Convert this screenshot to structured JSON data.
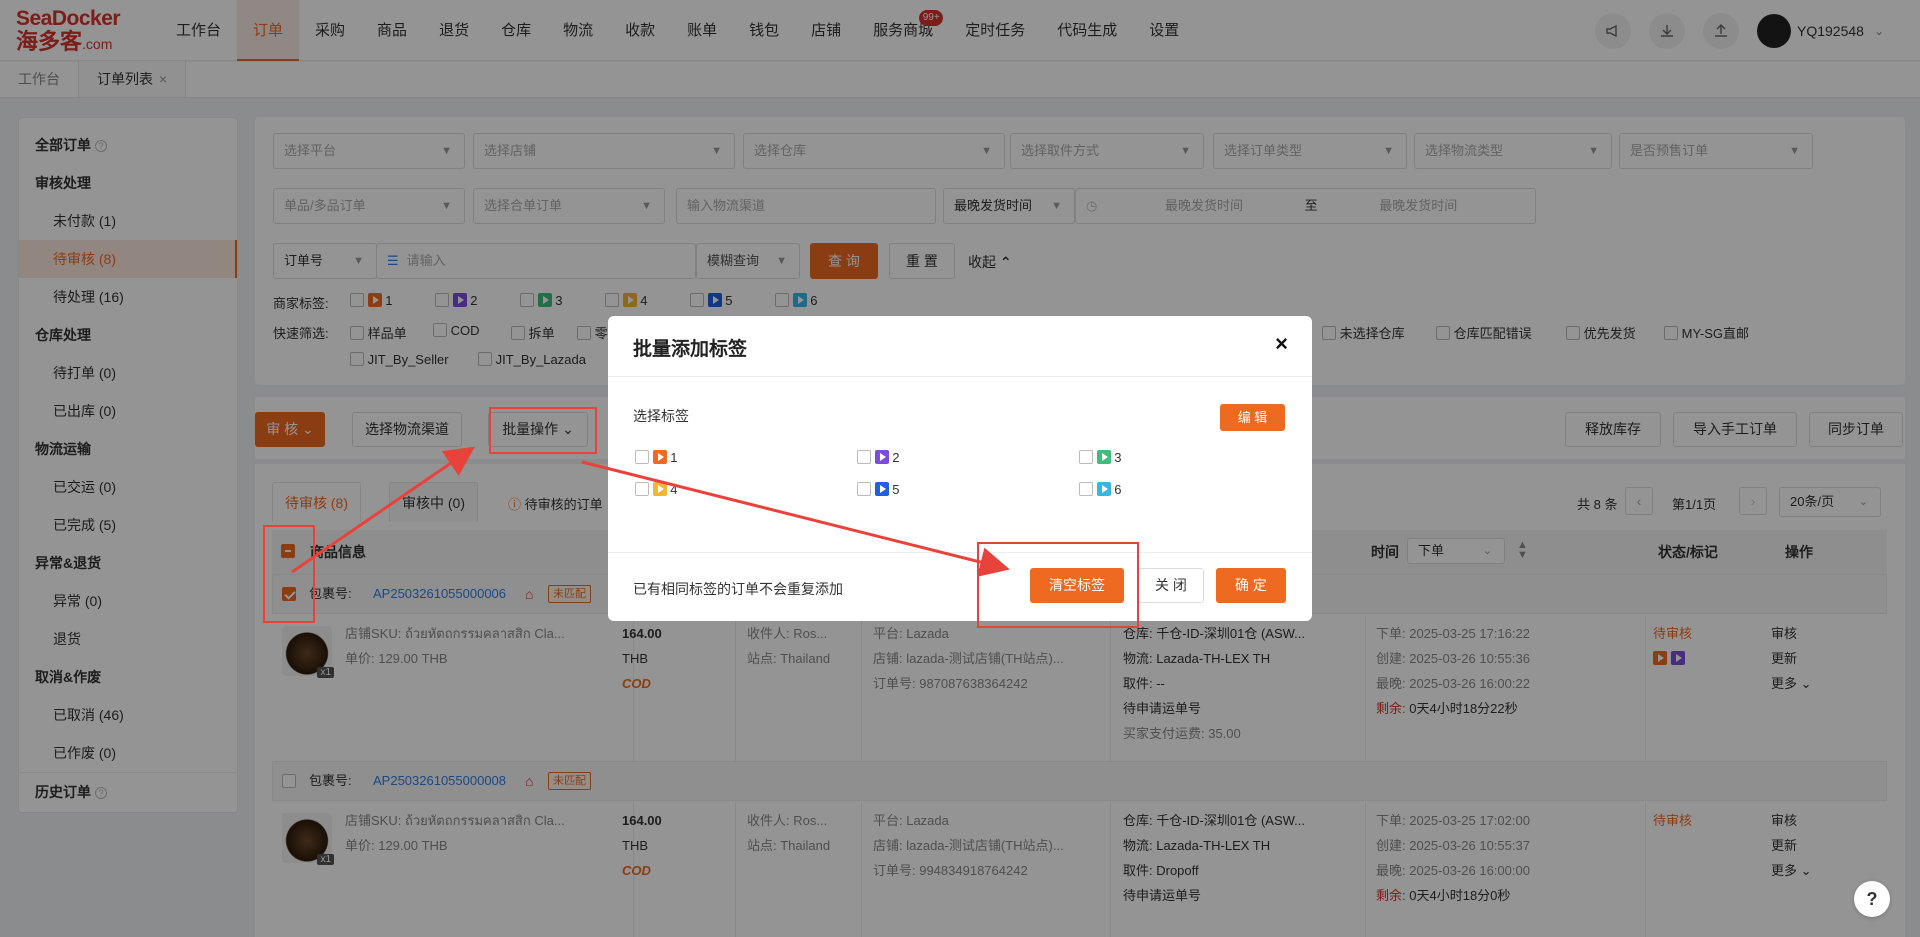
{
  "logo": {
    "top": "SeaDocker",
    "cn": "海多客",
    "suffix": ".com"
  },
  "nav": {
    "items": [
      "工作台",
      "订单",
      "采购",
      "商品",
      "退货",
      "仓库",
      "物流",
      "收款",
      "账单",
      "钱包",
      "店铺",
      "服务商城",
      "定时任务",
      "代码生成",
      "设置"
    ],
    "active_index": 1,
    "service_badge": "99+",
    "username": "YQ192548"
  },
  "page_tabs": [
    {
      "label": "工作台"
    },
    {
      "label": "订单列表",
      "close": "×"
    }
  ],
  "sidebar": {
    "all_orders": "全部订单",
    "groups": [
      {
        "title": "审核处理",
        "items": [
          "未付款 (1)",
          "待审核 (8)",
          "待处理 (16)"
        ]
      },
      {
        "title": "仓库处理",
        "items": [
          "待打单 (0)",
          "已出库 (0)"
        ]
      },
      {
        "title": "物流运输",
        "items": [
          "已交运 (0)",
          "已完成 (5)"
        ]
      },
      {
        "title": "异常&退货",
        "items": [
          "异常 (0)",
          "退货"
        ]
      },
      {
        "title": "取消&作废",
        "items": [
          "已取消 (46)",
          "已作废 (0)"
        ]
      }
    ],
    "history": "历史订单"
  },
  "filters": {
    "row1": [
      "选择平台",
      "选择店铺",
      "选择仓库",
      "选择取件方式",
      "选择订单类型",
      "选择物流类型",
      "是否预售订单"
    ],
    "row2": {
      "sku_type": "单品/多品订单",
      "merge": "选择合单订单",
      "channel_placeholder": "输入物流渠道",
      "time_type": "最晚发货时间",
      "range_start": "最晚发货时间",
      "range_sep": "至",
      "range_end": "最晚发货时间"
    },
    "row3": {
      "field": "订单号",
      "input_placeholder": "请输入",
      "match": "模糊查询",
      "query": "查 询",
      "reset": "重 置",
      "collapse": "收起"
    },
    "merchant_tags_label": "商家标签:",
    "merchant_tags": [
      "1",
      "2",
      "3",
      "4",
      "5",
      "6"
    ],
    "quick_label": "快速筛选:",
    "quick_items_left": [
      "样品单",
      "COD",
      "拆单",
      "零"
    ],
    "quick_items_right": [
      "未选择仓库",
      "仓库匹配错误",
      "优先发货",
      "MY-SG直邮"
    ],
    "quick_row2": [
      "JIT_By_Seller",
      "JIT_By_Lazada"
    ]
  },
  "actions": {
    "audit": "审 核",
    "select_channel": "选择物流渠道",
    "batch": "批量操作",
    "release": "释放库存",
    "import": "导入手工订单",
    "sync": "同步订单"
  },
  "subtabs": {
    "pending": "待审核 (8)",
    "reviewing": "审核中 (0)",
    "notice": "待审核的订单"
  },
  "pagination": {
    "total": "共 8 条",
    "page": "第1/1页",
    "size": "20条/页"
  },
  "table_header": {
    "product": "商品信息",
    "time": "时间",
    "time_select": "下单",
    "status": "状态/标记",
    "ops": "操作"
  },
  "orders": [
    {
      "pkg_label": "包裹号:",
      "pkg_no": "AP2503261055000006",
      "unmatched": "未匹配",
      "sku": "店铺SKU: ถ้วยหัตถกรรมคลาสสิก Cla...",
      "price": "单价: 129.00 THB",
      "qty": "x1",
      "amount": "164.00",
      "currency": "THB",
      "cod": "COD",
      "receiver": "收件人: Ros...",
      "site": "站点: Thailand",
      "platform": "平台: Lazada",
      "shop": "店铺: lazada-测试店铺(TH站点)...",
      "order_no": "订单号: 987087638364242",
      "warehouse": "仓库: 千仓-ID-深圳01仓 (ASW...",
      "logistics": "物流: Lazada-TH-LEX TH",
      "pickup": "取件: --",
      "tracking": "待申请运单号",
      "shipping_fee": "买家支付运费: 35.00",
      "t_order": "下单: 2025-03-25 17:16:22",
      "t_create": "创建: 2025-03-26 10:55:36",
      "t_latest": "最晚: 2025-03-26 16:00:22",
      "remain_label": "剩余:",
      "remain": "0天4小时18分22秒",
      "status": "待审核",
      "ops": [
        "审核",
        "更新",
        "更多"
      ]
    },
    {
      "pkg_label": "包裹号:",
      "pkg_no": "AP2503261055000008",
      "unmatched": "未匹配",
      "sku": "店铺SKU: ถ้วยหัตถกรรมคลาสสิก Cla...",
      "price": "单价: 129.00 THB",
      "qty": "x1",
      "amount": "164.00",
      "currency": "THB",
      "cod": "COD",
      "receiver": "收件人: Ros...",
      "site": "站点: Thailand",
      "platform": "平台: Lazada",
      "shop": "店铺: lazada-测试店铺(TH站点)...",
      "order_no": "订单号: 994834918764242",
      "warehouse": "仓库: 千仓-ID-深圳01仓 (ASW...",
      "logistics": "物流: Lazada-TH-LEX TH",
      "pickup": "取件: Dropoff",
      "tracking": "待申请运单号",
      "t_order": "下单: 2025-03-25 17:02:00",
      "t_create": "创建: 2025-03-26 10:55:37",
      "t_latest": "最晚: 2025-03-26 16:00:00",
      "remain_label": "剩余:",
      "remain": "0天4小时18分0秒",
      "status": "待审核",
      "ops": [
        "审核",
        "更新",
        "更多"
      ]
    }
  ],
  "modal": {
    "title": "批量添加标签",
    "close": "×",
    "select_label": "选择标签",
    "edit": "编 辑",
    "tags": [
      "1",
      "2",
      "3",
      "4",
      "5",
      "6"
    ],
    "note": "已有相同标签的订单不会重复添加",
    "clear": "清空标签",
    "cancel": "关 闭",
    "confirm": "确 定"
  },
  "colors": {
    "accent": "#ee6a21",
    "tag_colors": [
      "#f06a22",
      "#7c4ddb",
      "#3cbf7a",
      "#f2b632",
      "#1f5fe0",
      "#35b8e8"
    ],
    "annotation": "#e8433a"
  },
  "help": "?"
}
